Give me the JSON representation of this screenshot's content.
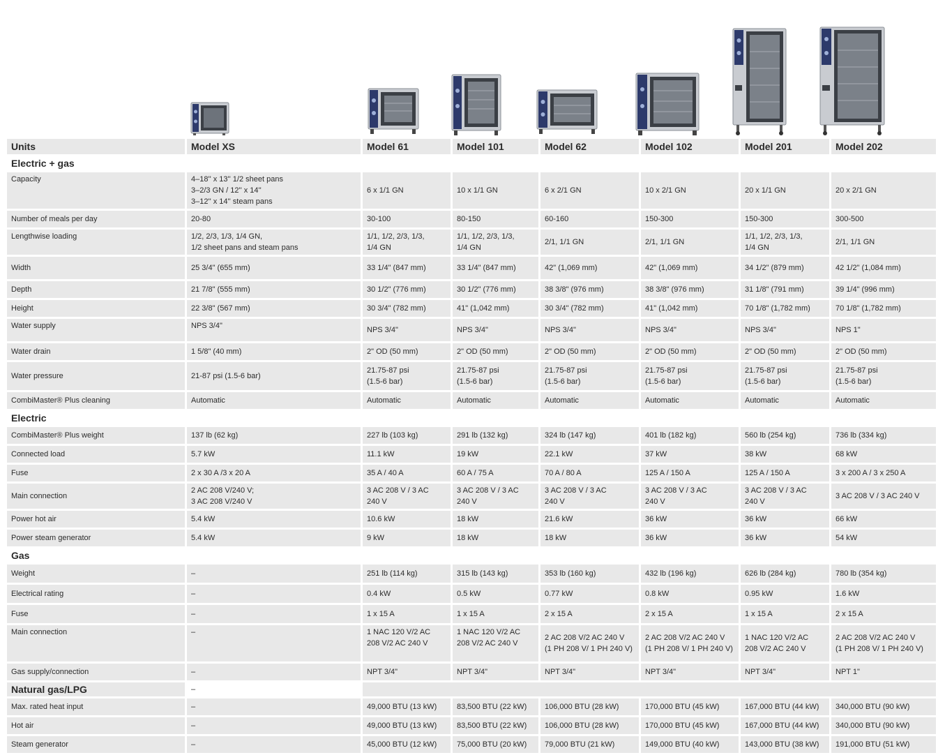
{
  "columns": [
    "Units",
    "Model XS",
    "Model 61",
    "Model 101",
    "Model 62",
    "Model 102",
    "Model 201",
    "Model 202"
  ],
  "images": [
    {
      "model": "Model XS",
      "icon": "oven-xs-image"
    },
    {
      "model": "Model 61",
      "icon": "oven-61-image"
    },
    {
      "model": "Model 101",
      "icon": "oven-101-image"
    },
    {
      "model": "Model 62",
      "icon": "oven-62-image"
    },
    {
      "model": "Model 102",
      "icon": "oven-102-image"
    },
    {
      "model": "Model 201",
      "icon": "oven-201-image"
    },
    {
      "model": "Model 202",
      "icon": "oven-202-image"
    }
  ],
  "colors": {
    "row_bg": "#e8e8e8",
    "text": "#2b2b2b",
    "accent_panel": "#2d3a6b"
  },
  "sections": [
    {
      "title": "Electric + gas",
      "rows": [
        {
          "label": "Capacity",
          "values": [
            "4–18'' x 13'' 1/2 sheet pans\n3–2/3 GN / 12'' x 14''\n3–12'' x 14'' steam pans",
            "6 x 1/1 GN",
            "10 x 1/1 GN",
            "6 x 2/1 GN",
            "10 x 2/1 GN",
            "20 x 1/1 GN",
            "20 x 2/1 GN"
          ]
        },
        {
          "label": "Number of meals per day",
          "values": [
            " 20-80",
            "30-100",
            "80-150",
            "60-160",
            "150-300",
            "150-300",
            "300-500"
          ]
        },
        {
          "label": "Lengthwise loading",
          "values": [
            "1/2, 2/3, 1/3, 1/4 GN,\n1/2 sheet pans and steam pans",
            "1/1, 1/2, 2/3, 1/3,\n1/4 GN",
            "1/1, 1/2, 2/3, 1/3,\n1/4 GN",
            "2/1, 1/1 GN",
            "2/1, 1/1 GN",
            "1/1, 1/2, 2/3, 1/3,\n1/4 GN",
            "2/1, 1/1 GN"
          ]
        },
        {
          "label": "Width",
          "values": [
            "25 3/4\" (655 mm)",
            "33 1/4\" (847 mm)",
            "33 1/4\" (847 mm)",
            "42\" (1,069 mm)",
            "42\" (1,069 mm)",
            "34 1/2\" (879 mm)",
            "42 1/2\" (1,084 mm)"
          ]
        },
        {
          "label": "Depth",
          "values": [
            "21 7/8\" (555 mm)",
            "30 1/2\" (776 mm)",
            "30 1/2\" (776 mm)",
            "38 3/8\" (976 mm)",
            "38 3/8\" (976 mm)",
            "31 1/8\" (791 mm)",
            "39 1/4\" (996 mm)"
          ]
        },
        {
          "label": "Height",
          "values": [
            "22 3/8\" (567 mm)",
            "30 3/4\" (782 mm)",
            "41\" (1,042 mm)",
            "30 3/4\" (782 mm)",
            "41\" (1,042 mm)",
            "70 1/8\" (1,782 mm)",
            "70 1/8\" (1,782 mm)"
          ]
        },
        {
          "label": "Water supply",
          "values": [
            "NPS 3/4\"",
            "NPS 3/4\"",
            "NPS 3/4\"",
            "NPS 3/4\"",
            "NPS 3/4\"",
            "NPS 3/4\"",
            "NPS 1\""
          ]
        },
        {
          "label": "Water drain",
          "values": [
            "1 5/8\" (40 mm)",
            "2\" OD (50 mm)",
            "2\" OD (50 mm)",
            "2\" OD (50 mm)",
            "2\" OD (50 mm)",
            "2\" OD (50 mm)",
            "2\" OD (50 mm)"
          ]
        },
        {
          "label": "Water pressure",
          "values": [
            "21-87 psi (1.5-6 bar)",
            "21.75-87 psi\n(1.5-6 bar)",
            "21.75-87 psi\n(1.5-6 bar)",
            "21.75-87 psi\n(1.5-6 bar)",
            "21.75-87 psi\n(1.5-6 bar)",
            "21.75-87 psi\n(1.5-6 bar)",
            "21.75-87 psi\n(1.5-6 bar)"
          ]
        },
        {
          "label": "CombiMaster® Plus cleaning",
          "values": [
            "Automatic",
            "Automatic",
            "Automatic",
            "Automatic",
            "Automatic",
            "Automatic",
            "Automatic"
          ]
        }
      ]
    },
    {
      "title": "Electric",
      "rows": [
        {
          "label": "CombiMaster® Plus weight",
          "values": [
            "137 lb (62 kg)",
            "227 lb (103 kg)",
            "291 lb (132 kg)",
            "324 lb (147 kg)",
            "401 lb (182 kg)",
            "560 lb (254 kg)",
            "736 lb (334 kg)"
          ]
        },
        {
          "label": "Connected load",
          "values": [
            "5.7 kW",
            "11.1 kW",
            "19 kW",
            "22.1 kW",
            "37 kW",
            "38 kW",
            "68 kW"
          ]
        },
        {
          "label": "Fuse",
          "values": [
            "2 x 30 A /3 x 20 A",
            "35 A / 40 A",
            "60 A / 75 A",
            "70 A / 80 A",
            "125 A / 150 A",
            "125 A / 150 A",
            "3 x 200 A / 3 x 250 A"
          ]
        },
        {
          "label": "Main connection",
          "values": [
            "2 AC 208 V/240 V;\n3 AC 208 V/240 V",
            "3 AC 208 V / 3 AC\n240 V",
            "3 AC 208 V / 3 AC\n240 V",
            "3 AC 208 V / 3 AC\n240 V",
            "3 AC 208 V / 3 AC\n240 V",
            "3 AC 208 V / 3 AC\n240 V",
            "3 AC 208 V / 3 AC 240 V"
          ]
        },
        {
          "label": "Power hot air",
          "values": [
            "5.4 kW",
            "10.6 kW",
            "18 kW",
            "21.6 kW",
            "36 kW",
            "36 kW",
            "66 kW"
          ]
        },
        {
          "label": "Power steam generator",
          "values": [
            "5.4 kW",
            "9 kW",
            "18 kW",
            "18 kW",
            "36 kW",
            "36 kW",
            "54 kW"
          ]
        }
      ]
    },
    {
      "title": "Gas",
      "rows": [
        {
          "label": "Weight",
          "values": [
            "–",
            "251 lb (114 kg)",
            "315 lb (143 kg)",
            "353 lb (160 kg)",
            "432 lb (196 kg)",
            "626 lb (284 kg)",
            "780 lb (354 kg)"
          ]
        },
        {
          "label": "Electrical rating",
          "values": [
            "–",
            "0.4 kW",
            "0.5 kW",
            "0.77 kW",
            "0.8 kW",
            "0.95 kW",
            "1.6 kW"
          ]
        },
        {
          "label": "Fuse",
          "values": [
            "–",
            "1 x 15 A",
            "1 x 15 A",
            "2 x 15 A",
            "2 x 15 A",
            "1 x 15 A",
            "2 x 15 A"
          ]
        },
        {
          "label": "Main connection",
          "values": [
            "–",
            "1 NAC 120 V/2 AC\n208 V/2 AC 240 V",
            "1 NAC 120 V/2 AC\n208 V/2 AC 240 V",
            "2 AC 208 V/2 AC 240 V\n(1 PH 208 V/ 1 PH 240 V)",
            "2 AC 208 V/2 AC 240 V\n(1 PH 208 V/ 1 PH 240 V)",
            "1 NAC 120 V/2 AC\n208 V/2 AC 240 V",
            "2 AC 208 V/2 AC 240 V\n(1 PH 208 V/ 1 PH 240 V)"
          ]
        },
        {
          "label": "Gas supply/connection",
          "values": [
            "–",
            "NPT 3/4\"",
            "NPT 3/4\"",
            "NPT 3/4\"",
            "NPT 3/4\"",
            "NPT 3/4\"",
            "NPT 1\""
          ]
        }
      ]
    },
    {
      "title": "Natural gas/LPG",
      "title_value": "–",
      "rows": [
        {
          "label": "Max. rated heat input",
          "values": [
            "–",
            "49,000 BTU (13 kW)",
            "83,500 BTU (22 kW)",
            "106,000 BTU (28 kW)",
            "170,000 BTU (45 kW)",
            "167,000 BTU (44 kW)",
            "340,000 BTU (90 kW)"
          ]
        },
        {
          "label": "Hot air",
          "values": [
            "–",
            "49,000 BTU (13 kW)",
            "83,500 BTU (22 kW)",
            "106,000 BTU (28 kW)",
            "170,000 BTU (45 kW)",
            "167,000 BTU (44 kW)",
            "340,000 BTU (90 kW)"
          ]
        },
        {
          "label": "Steam generator",
          "values": [
            "–",
            "45,000 BTU (12 kW)",
            "75,000 BTU (20 kW)",
            "79,000 BTU (21 kW)",
            "149,000 BTU (40 kW)",
            "143,000 BTU (38 kW)",
            "191,000 BTU (51 kW)"
          ]
        }
      ]
    }
  ]
}
